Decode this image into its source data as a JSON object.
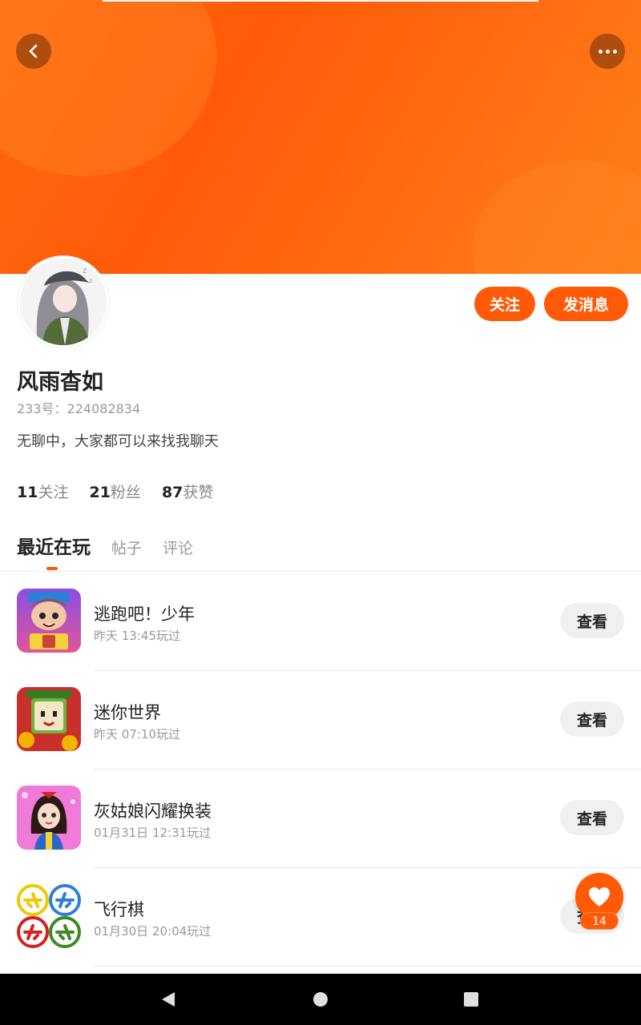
{
  "header": {
    "back_icon": "chevron-left-icon",
    "more_icon": "more-dots-icon"
  },
  "profile": {
    "name": "风雨杳如",
    "uid_label": "233号：224082834",
    "bio": "无聊中，大家都可以来找我聊天",
    "follow_button": "关注",
    "message_button": "发消息",
    "stats": [
      {
        "num": "11",
        "label": "关注"
      },
      {
        "num": "21",
        "label": "粉丝"
      },
      {
        "num": "87",
        "label": "获赞"
      }
    ]
  },
  "tabs": [
    {
      "label": "最近在玩",
      "active": true
    },
    {
      "label": "帖子",
      "active": false
    },
    {
      "label": "评论",
      "active": false
    }
  ],
  "games": [
    {
      "name": "逃跑吧！少年",
      "time": "昨天 13:45玩过",
      "button": "查看"
    },
    {
      "name": "迷你世界",
      "time": "昨天 07:10玩过",
      "button": "查看"
    },
    {
      "name": "灰姑娘闪耀换装",
      "time": "01月31日 12:31玩过",
      "button": "查看"
    },
    {
      "name": "飞行棋",
      "time": "01月30日 20:04玩过",
      "button": "查看"
    }
  ],
  "like_fab": {
    "icon": "heart-icon",
    "count": "14"
  },
  "colors": {
    "accent": "#ff5a08",
    "banner": "#ff6a10"
  }
}
